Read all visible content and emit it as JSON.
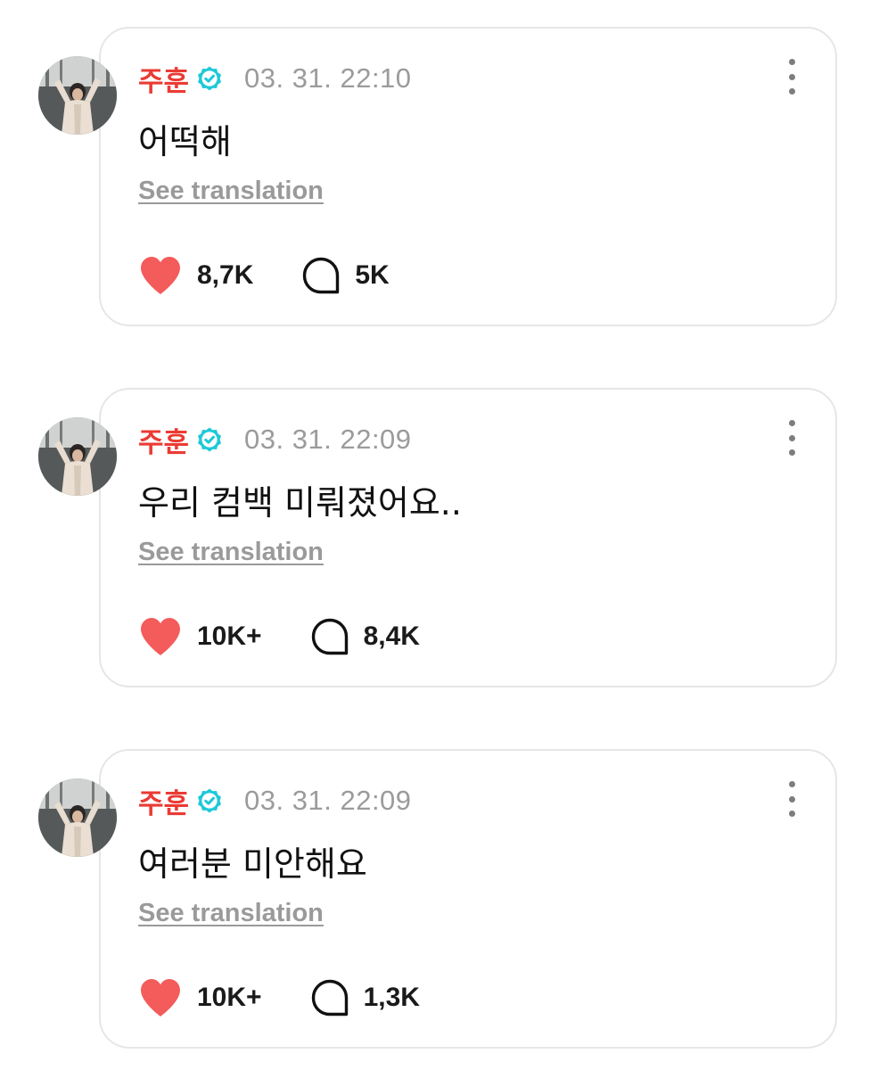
{
  "colors": {
    "author": "#ea3b34",
    "verified": "#1ec9d8",
    "like": "#f45b5b",
    "timestamp": "#9b9b9b",
    "card_border": "#e6e6e6"
  },
  "icons": {
    "verified": "verified-badge-icon",
    "like": "heart-icon",
    "comment": "speech-bubble-icon",
    "menu": "more-vertical-icon"
  },
  "posts": [
    {
      "author": "주훈",
      "timestamp": "03. 31. 22:10",
      "text": "어떡해",
      "translate_label": "See translation",
      "likes": "8,7K",
      "comments": "5K"
    },
    {
      "author": "주훈",
      "timestamp": "03. 31. 22:09",
      "text": "우리 컴백 미뤄졌어요..",
      "translate_label": "See translation",
      "likes": "10K+",
      "comments": "8,4K"
    },
    {
      "author": "주훈",
      "timestamp": "03. 31. 22:09",
      "text": "여러분 미안해요",
      "translate_label": "See translation",
      "likes": "10K+",
      "comments": "1,3K"
    }
  ]
}
